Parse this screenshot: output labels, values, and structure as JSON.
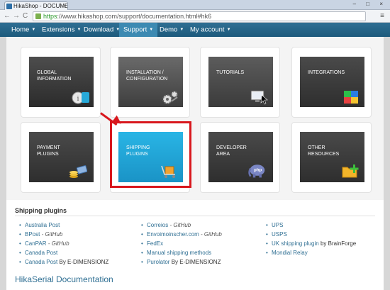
{
  "browser": {
    "tab_title": "HikaShop - DOCUMENTA",
    "tab_close": "×",
    "window_controls": "– □ ×",
    "nav_back": "←",
    "nav_forward": "→",
    "nav_reload": "C",
    "url_https": "https",
    "url_rest": "://www.hikashop.com/support/documentation.html#hk6",
    "menu_glyph": "≡"
  },
  "sitenav": {
    "items": [
      {
        "label": "Home",
        "caret": "▼"
      },
      {
        "label": "Extensions",
        "caret": "▼"
      },
      {
        "label": "Download",
        "caret": "▼"
      },
      {
        "label": "Support",
        "caret": "▼",
        "active": true
      },
      {
        "label": "Demo",
        "caret": "▼"
      },
      {
        "label": "My account",
        "caret": "▼"
      }
    ]
  },
  "tiles": [
    {
      "line1": "GLOBAL",
      "line2": "INFORMATION",
      "icon": "info-icon",
      "color": "#3a3a3a"
    },
    {
      "line1": "INSTALLATION /",
      "line2": "CONFIGURATION",
      "icon": "gears-icon",
      "color": "#4a4a4a"
    },
    {
      "line1": "TUTORIALS",
      "line2": "",
      "icon": "monitor-cursor-icon",
      "color": "#4a4a4a"
    },
    {
      "line1": "INTEGRATIONS",
      "line2": "",
      "icon": "puzzle-icon",
      "color": "#3a3a3a"
    },
    {
      "line1": "PAYMENT",
      "line2": "PLUGINS",
      "icon": "coins-card-icon",
      "color": "#3a3a3a"
    },
    {
      "line1": "SHIPPING",
      "line2": "PLUGINS",
      "icon": "cart-box-icon",
      "color": "#22a7d6"
    },
    {
      "line1": "DEVELOPER",
      "line2": "AREA",
      "icon": "php-elephant-icon",
      "color": "#3a3a3a"
    },
    {
      "line1": "OTHER",
      "line2": "RESOURCES",
      "icon": "folder-plus-icon",
      "color": "#3a3a3a"
    }
  ],
  "shipping": {
    "title": "Shipping plugins",
    "col1": [
      {
        "link": "Australia Post",
        "suffix": ""
      },
      {
        "link": "BPost",
        "suffix": " - GitHub"
      },
      {
        "link": "CanPAR",
        "suffix": " - GitHub"
      },
      {
        "link": "Canada Post",
        "suffix": ""
      },
      {
        "link": "Canada Post",
        "suffix": " By E-DIMENSIONZ",
        "plain": true
      }
    ],
    "col2": [
      {
        "link": "Correios",
        "suffix": " - GitHub"
      },
      {
        "link": "Envoimoinscher.com",
        "suffix": " - GitHub"
      },
      {
        "link": "FedEx",
        "suffix": ""
      },
      {
        "link": "Manual shipping methods",
        "suffix": ""
      },
      {
        "link": "Purolator",
        "suffix": " By E-DIMENSIONZ",
        "plain": true
      }
    ],
    "col3": [
      {
        "link": "UPS",
        "suffix": ""
      },
      {
        "link": "USPS",
        "suffix": ""
      },
      {
        "link": "UK shipping plugin",
        "suffix": " by BrainForge",
        "plain": true
      },
      {
        "link": "Mondial Relay",
        "suffix": ""
      }
    ]
  },
  "next_heading": "HikaSerial Documentation"
}
